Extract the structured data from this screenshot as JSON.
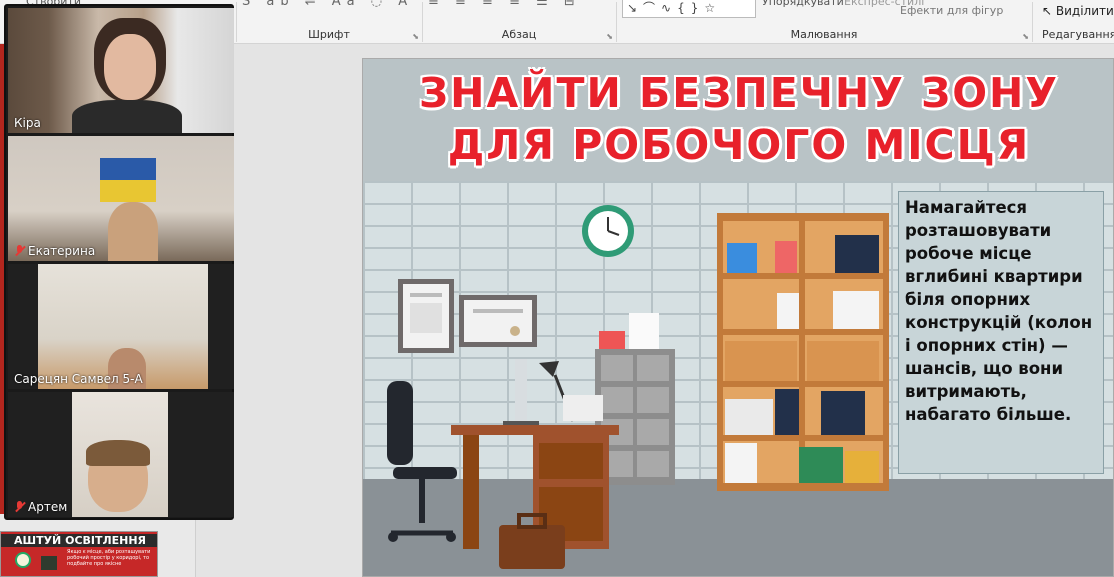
{
  "ribbon": {
    "group_create_label": "Створити",
    "group_font_label": "Шрифт",
    "group_paragraph_label": "Абзац",
    "group_drawing_label": "Малювання",
    "group_editing_label": "Редагування",
    "arrange_label": "Упорядкувати",
    "express_styles_label": "Експрес-стилі",
    "shape_effects_label": "Ефекти для фігур",
    "select_label": "Виділити"
  },
  "participants": [
    {
      "name": "Кіра",
      "muted": false
    },
    {
      "name": "Екатерина",
      "muted": true
    },
    {
      "name": "Сарецян Самвел 5-А",
      "muted": false
    },
    {
      "name": "Артем",
      "muted": true
    }
  ],
  "slide": {
    "title_line1": "ЗНАЙТИ БЕЗПЕЧНУ ЗОНУ",
    "title_line2": "ДЛЯ РОБОЧОГО МІСЦЯ",
    "body_text": "Намагайтеся розташовувати робоче місце вглибині квартири біля опорних конструкцій (колон і опорних стін) — шансів, що вони витримають, набагато більше."
  },
  "thumbnail_next": {
    "title": "АШТУЙ ОСВІТЛЕННЯ",
    "snippet": "Якщо є місце, аби розташувати робочий простір у коридорі, то подбайте про якісне"
  },
  "colors": {
    "title_red": "#e8212b",
    "slide_bg": "#b9c3c6",
    "textbox_bg": "#c8d5d8"
  }
}
